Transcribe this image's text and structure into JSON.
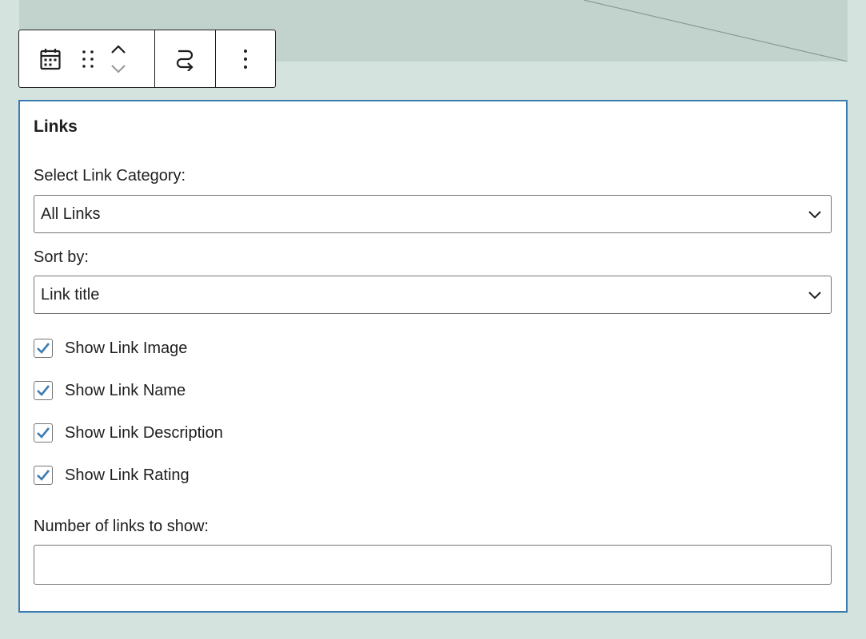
{
  "toolbar": {
    "block_icon": "calendar-icon",
    "drag_icon": "drag-handle-icon",
    "move_up_icon": "chevron-up-icon",
    "move_down_icon": "chevron-down-icon",
    "transform_icon": "loop-arrow-icon",
    "options_icon": "more-vertical-icon"
  },
  "panel": {
    "title": "Links",
    "category_label": "Select Link Category:",
    "category_value": "All Links",
    "sort_label": "Sort by:",
    "sort_value": "Link title",
    "checkboxes": [
      {
        "label": "Show Link Image",
        "checked": true
      },
      {
        "label": "Show Link Name",
        "checked": true
      },
      {
        "label": "Show Link Description",
        "checked": true
      },
      {
        "label": "Show Link Rating",
        "checked": true
      }
    ],
    "number_label": "Number of links to show:",
    "number_value": ""
  },
  "colors": {
    "background": "#d4e3dd",
    "band": "#c2d3cd",
    "panel_border": "#3c7bb0",
    "checkmark": "#3c7bb0"
  }
}
